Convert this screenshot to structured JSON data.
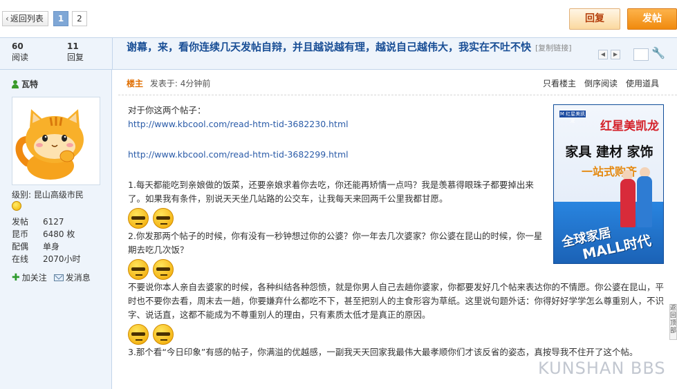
{
  "toolbar": {
    "back_label": "返回列表",
    "pages": [
      "1",
      "2"
    ],
    "active_page": "1",
    "reply_label": "回复",
    "post_label": "发帖"
  },
  "thread": {
    "views_count": "60",
    "views_label": "阅读",
    "replies_count": "11",
    "replies_label": "回复",
    "title": "谢幕，来，看你连续几天发帖自辩，并且越说越有理，越说自己越伟大，我实在不吐不快",
    "copy_link": "[复制链接]"
  },
  "author": {
    "name": "瓦特",
    "level": "级别: 昆山高级市民",
    "stats": [
      {
        "key": "发帖",
        "value": "6127"
      },
      {
        "key": "昆币",
        "value": "6480 枚"
      },
      {
        "key": "配偶",
        "value": "单身"
      },
      {
        "key": "在线",
        "value": "2070小时"
      }
    ],
    "follow_label": "加关注",
    "message_label": "发消息"
  },
  "post": {
    "op_badge": "楼主",
    "time": "发表于: 4分钟前",
    "meta_links": [
      "只看楼主",
      "倒序阅读",
      "使用道具"
    ],
    "intro": "对于你这两个帖子：",
    "link1": "http://www.kbcool.com/read-htm-tid-3682230.html",
    "link2": "http://www.kbcool.com/read-htm-tid-3682299.html",
    "para1": "1.每天都能吃到亲娘做的饭菜，还要亲娘求着你去吃，你还能再矫情一点吗？我是羡慕得眼珠子都要掉出来了。如果我有条件，别说天天坐几站路的公交车，让我每天来回两千公里我都甘愿。",
    "para2": "2.你发那两个帖子的时候，你有没有一秒钟想过你的公婆？你一年去几次婆家？你公婆在昆山的时候，你一星期去吃几次饭？",
    "para3": "不要说你本人亲自去婆家的时候，各种纠结各种怨愤，就是你男人自己去趟你婆家，你都要发好几个帖来表达你的不情愿。你公婆在昆山，平时也不要你去看，周末去一趟，你要嫌弃什么都吃不下，甚至把别人的主食形容为草纸。这里说句题外话：你得好好学学怎么尊重别人，不识字、说话直，这都不能成为不尊重别人的理由，只有素质太低才是真正的原因。",
    "para4": "3.那个看“今日印象”有感的帖子，你满溢的优越感，一副我天天回家我最伟大最孝顺你们才该反省的姿态，真按导我不住开了这个帖。"
  },
  "ad": {
    "logo": "M 红星美凯龙",
    "brand": "红星美凯龙",
    "categories": "家具 建材 家饰",
    "oneshop": "一站式购齐",
    "slogan1": "全球家居",
    "slogan2": "MALL时代"
  },
  "side_tab": "返回顶部",
  "watermark": "KUNSHAN BBS"
}
